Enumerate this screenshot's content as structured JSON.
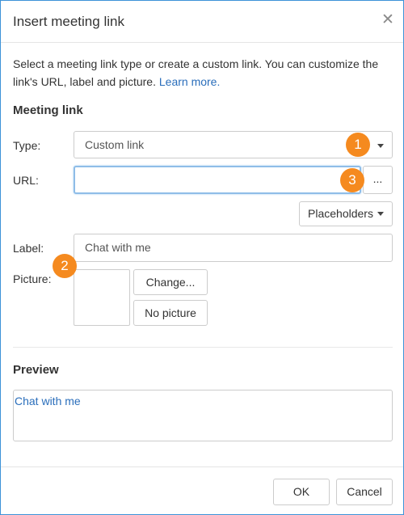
{
  "dialog": {
    "title": "Insert meeting link",
    "close_glyph": "✕"
  },
  "description": {
    "text": "Select a meeting link type or create a custom link. You can customize the link's URL, label and picture. ",
    "link": "Learn more."
  },
  "meeting_link": {
    "heading": "Meeting link",
    "type_label": "Type:",
    "type_value": "Custom link",
    "url_label": "URL:",
    "url_value": "",
    "url_browse_label": "...",
    "placeholders_label": "Placeholders",
    "label_label": "Label:",
    "label_value": "Chat with me",
    "picture_label": "Picture:",
    "change_label": "Change...",
    "no_picture_label": "No picture"
  },
  "preview": {
    "heading": "Preview",
    "text": "Chat with me"
  },
  "footer": {
    "ok_label": "OK",
    "cancel_label": "Cancel"
  },
  "callouts": [
    "1",
    "2",
    "3"
  ],
  "colors": {
    "accent_border": "#3d93d8",
    "link": "#2a6ebb",
    "callout": "#f58a1f"
  }
}
